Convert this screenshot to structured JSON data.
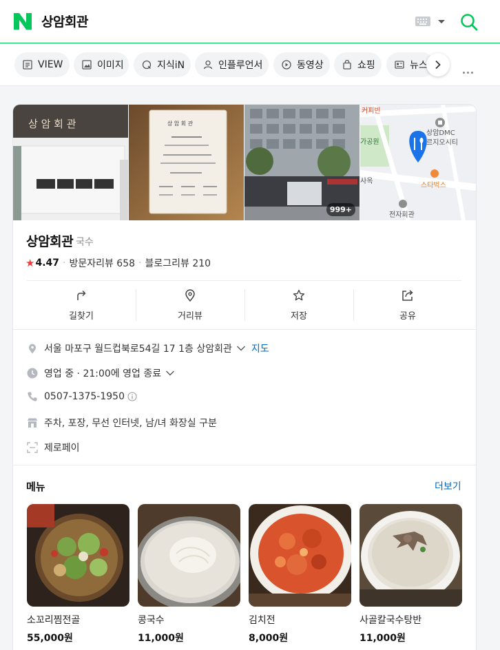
{
  "header": {
    "query": "상암회관"
  },
  "tabs": [
    {
      "label": "VIEW",
      "icon": "view-icon"
    },
    {
      "label": "이미지",
      "icon": "image-icon"
    },
    {
      "label": "지식iN",
      "icon": "q-icon"
    },
    {
      "label": "인플루언서",
      "icon": "person-icon"
    },
    {
      "label": "동영상",
      "icon": "play-icon"
    },
    {
      "label": "쇼핑",
      "icon": "shopping-bag-icon"
    },
    {
      "label": "뉴스",
      "icon": "news-icon"
    }
  ],
  "place": {
    "name": "상암회관",
    "category": "국수",
    "star": "★",
    "rating": "4.47",
    "visitor_reviews": "방문자리뷰 658",
    "blog_reviews": "블로그리뷰 210",
    "photo_count": "999+",
    "photo_texts": {
      "sign": "상 암 회 관",
      "menu_title": "상 암 회 관",
      "map_cafe": "커피빈",
      "map_building1": "상암DMC",
      "map_building2": "르지오시티",
      "map_park": "가공원",
      "map_starbucks": "스타벅스",
      "map_road": "사옥",
      "map_place": "전자회관"
    },
    "actions": [
      {
        "label": "길찾기"
      },
      {
        "label": "거리뷰"
      },
      {
        "label": "저장"
      },
      {
        "label": "공유"
      }
    ],
    "address": "서울 마포구 월드컵북로54길 17 1층 상암회관",
    "map_link": "지도",
    "hours": "영업 중 · 21:00에 영업 종료",
    "phone": "0507-1375-1950",
    "amenities": "주차, 포장, 무선 인터넷, 남/녀 화장실 구분",
    "pay": "제로페이"
  },
  "menu": {
    "title": "메뉴",
    "more": "더보기",
    "items": [
      {
        "name": "소꼬리찜전골",
        "price": "55,000원"
      },
      {
        "name": "콩국수",
        "price": "11,000원"
      },
      {
        "name": "김치전",
        "price": "8,000원"
      },
      {
        "name": "사골칼국수탕반",
        "price": "11,000원"
      }
    ]
  },
  "colors": {
    "brand": "#03c75a",
    "link": "#0068c3",
    "star": "#ee3c3c"
  }
}
